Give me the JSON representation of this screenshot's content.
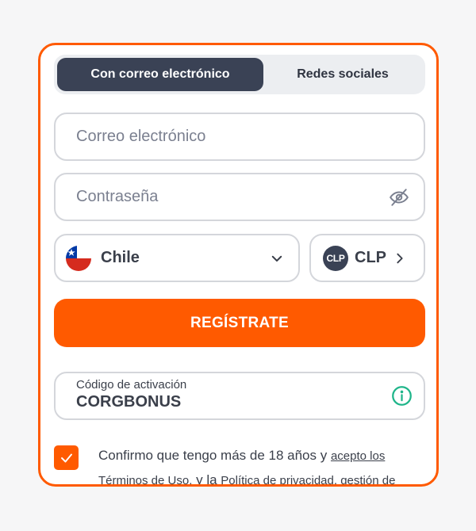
{
  "tabs": [
    {
      "label": "Con correo electrónico",
      "active": true
    },
    {
      "label": "Redes sociales",
      "active": false
    }
  ],
  "form": {
    "email_placeholder": "Correo electrónico",
    "password_placeholder": "Contraseña",
    "country": "Chile",
    "currency": "CLP",
    "currency_badge": "CLP",
    "register_label": "REGÍSTRATE",
    "promo_label": "Código de activación",
    "promo_value": "CORGBONUS"
  },
  "consent": {
    "checked": true,
    "text_1": "Confirmo que tengo más de 18 años y ",
    "link_1": "acepto los Términos de Uso.",
    "text_2": " y la ",
    "link_2": "Política de privacidad, gestión de"
  },
  "colors": {
    "accent": "#ff5a00",
    "dark": "#3a4255",
    "border": "#d4d6db",
    "info_icon": "#1fb58a"
  },
  "icons": [
    "eye-off-icon",
    "chile-flag-icon",
    "chevron-down-icon",
    "chevron-right-icon",
    "info-icon",
    "checkmark-icon"
  ]
}
